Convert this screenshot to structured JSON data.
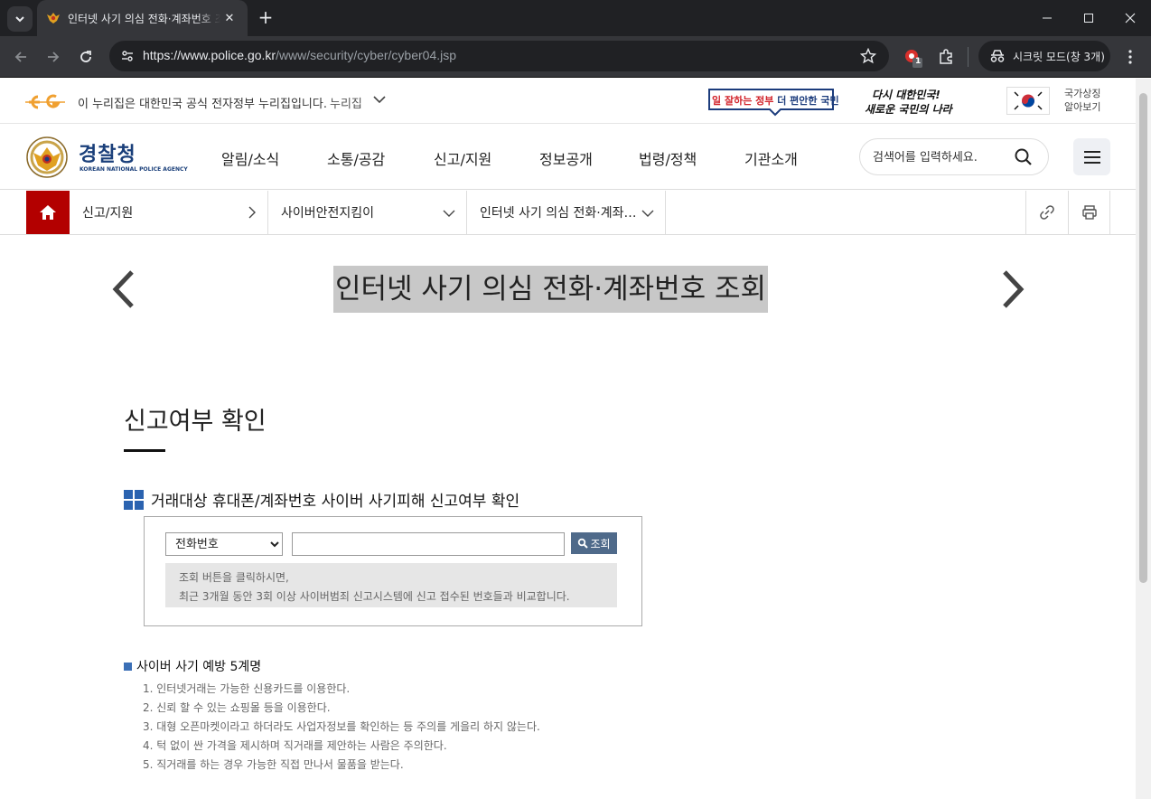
{
  "browser": {
    "tab_title": "인터넷 사기 의심 전화·계좌번호 조회",
    "url_host": "https://www.police.go.kr",
    "url_path": "/www/security/cyber/cyber04.jsp",
    "extension_badge": "1",
    "incognito_label": "시크릿 모드(창 3개)"
  },
  "gov_banner": {
    "text": "이 누리집은 대한민국 공식 전자정부 누리집입니다.",
    "nuri_label": "누리집",
    "slogan1_part1": "일 잘하는 정부",
    "slogan1_part2": "더 편안한 국민",
    "slogan2_line1": "다시 대한민국!",
    "slogan2_line2": "새로운 국민의 나라",
    "national_symbols_line1": "국가상징",
    "national_symbols_line2": "알아보기"
  },
  "header": {
    "logo_name": "경찰청",
    "logo_en": "KOREAN NATIONAL POLICE AGENCY",
    "nav": [
      "알림/소식",
      "소통/공감",
      "신고/지원",
      "정보공개",
      "법령/정책",
      "기관소개"
    ],
    "search_placeholder": "검색어를 입력하세요."
  },
  "location": {
    "level1": "신고/지원",
    "level2": "사이버안전지킴이",
    "level3": "인터넷 사기 의심 전화·계좌…"
  },
  "page_title": "인터넷 사기 의심 전화·계좌번호 조회",
  "section_title": "신고여부 확인",
  "check": {
    "heading": "거래대상 휴대폰/계좌번호 사이버 사기피해 신고여부 확인",
    "select_value": "전화번호",
    "select_options": [
      "전화번호"
    ],
    "button_label": "조회",
    "note_line1": "조회 버튼을 클릭하시면,",
    "note_line2": "최근 3개월 동안 3회 이상 사이버범죄 신고시스템에 신고 접수된 번호들과 비교합니다."
  },
  "tips": {
    "heading": "사이버 사기 예방 5계명",
    "items": [
      "1. 인터넷거래는 가능한 신용카드를 이용한다.",
      "2. 신뢰 할 수 있는 쇼핑몰 등을 이용한다.",
      "3. 대형 오픈마켓이라고 하더라도 사업자정보를 확인하는 등 주의를 게을리 하지 않는다.",
      "4. 턱 없이 싼 가격을 제시하며 직거래를 제안하는 사람은 주의한다.",
      "5. 직거래를 하는 경우 가능한 직접 만나서 물품을 받는다."
    ]
  },
  "colors": {
    "home_red": "#b30000",
    "brand_navy": "#1a3f7a",
    "button_blue": "#4f6a8a",
    "bullet_blue": "#3b6fb6"
  }
}
